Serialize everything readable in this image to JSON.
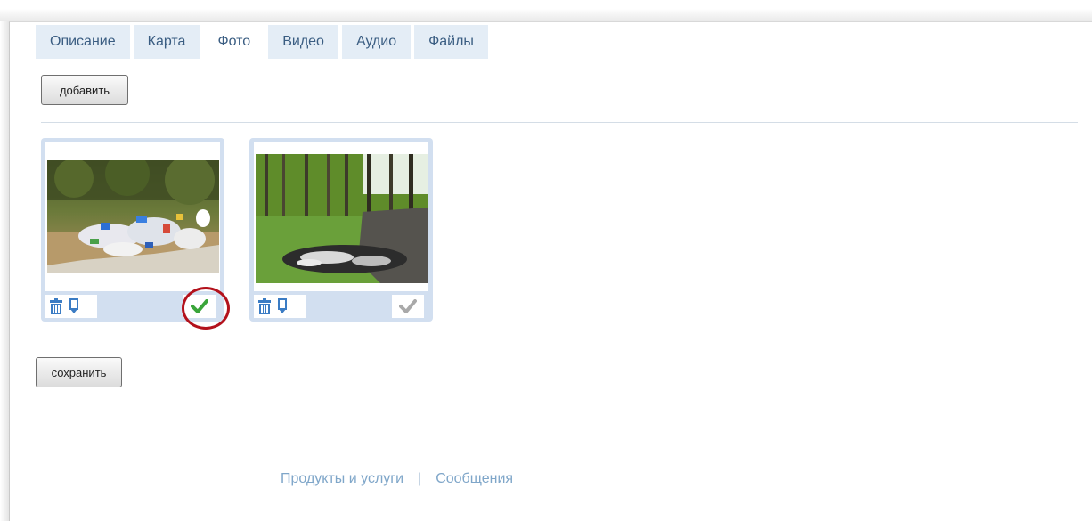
{
  "tabs": [
    {
      "label": "Описание",
      "active": false
    },
    {
      "label": "Карта",
      "active": false
    },
    {
      "label": "Фото",
      "active": true
    },
    {
      "label": "Видео",
      "active": false
    },
    {
      "label": "Аудио",
      "active": false
    },
    {
      "label": "Файлы",
      "active": false
    }
  ],
  "buttons": {
    "add_label": "добавить",
    "save_label": "сохранить"
  },
  "photos": [
    {
      "subject": "garbage pile in forest undergrowth",
      "is_main": true
    },
    {
      "subject": "garbage dumped near park path among trees",
      "is_main": false
    }
  ],
  "icons": {
    "delete": "trash-icon",
    "edit": "pin-icon",
    "main_selected": "check-icon-green",
    "main_unselected": "check-icon-gray"
  },
  "colors": {
    "tab_bg": "#e4edf6",
    "tab_text": "#3a5d82",
    "card_border": "#d2dff0",
    "icon_blue": "#3b7cc4",
    "check_green": "#3aa53a",
    "check_gray": "#a9a9a9",
    "highlight": "#b3121c",
    "link": "#7fa6c9"
  },
  "footer": {
    "link1": "Продукты и услуги",
    "separator": "|",
    "link2": "Сообщения"
  }
}
